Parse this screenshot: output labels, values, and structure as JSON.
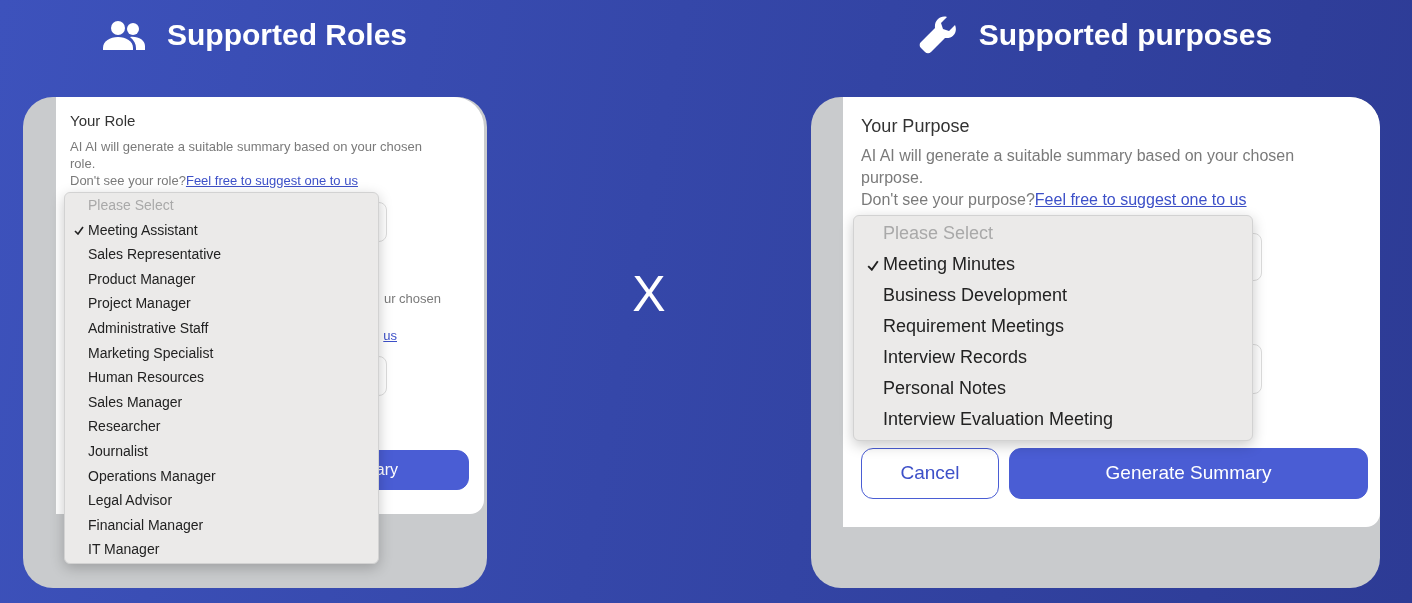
{
  "panels": [
    {
      "heading": "Supported Roles",
      "title": "Your Role",
      "description": "AI AI will generate a suitable summary based on your chosen role.",
      "prompt": "Don't see your role?",
      "link": "Feel free to suggest one to us",
      "covered_description": "ur chosen",
      "covered_link": "us",
      "buttons": [
        {
          "label": "ary",
          "kind": "primary"
        }
      ],
      "dropdown": {
        "placeholder": "Please Select",
        "options": [
          {
            "label": "Meeting Assistant",
            "selected": true
          },
          {
            "label": "Sales Representative",
            "selected": false
          },
          {
            "label": "Product Manager",
            "selected": false
          },
          {
            "label": "Project Manager",
            "selected": false
          },
          {
            "label": "Administrative Staff",
            "selected": false
          },
          {
            "label": "Marketing Specialist",
            "selected": false
          },
          {
            "label": "Human Resources",
            "selected": false
          },
          {
            "label": "Sales Manager",
            "selected": false
          },
          {
            "label": "Researcher",
            "selected": false
          },
          {
            "label": "Journalist",
            "selected": false
          },
          {
            "label": "Operations Manager",
            "selected": false
          },
          {
            "label": "Legal Advisor",
            "selected": false
          },
          {
            "label": "Financial Manager",
            "selected": false
          },
          {
            "label": "IT Manager",
            "selected": false
          }
        ]
      }
    },
    {
      "heading": "Supported purposes",
      "title": "Your Purpose",
      "description": "AI AI will generate a suitable summary based on your chosen purpose.",
      "prompt": "Don't see your purpose?",
      "link": "Feel free to suggest one to us",
      "buttons": [
        {
          "label": "Cancel",
          "kind": "outline"
        },
        {
          "label": "Generate Summary",
          "kind": "primary"
        }
      ],
      "dropdown": {
        "placeholder": "Please Select",
        "options": [
          {
            "label": "Meeting Minutes",
            "selected": true
          },
          {
            "label": "Business Development",
            "selected": false
          },
          {
            "label": "Requirement Meetings",
            "selected": false
          },
          {
            "label": "Interview Records",
            "selected": false
          },
          {
            "label": "Personal Notes",
            "selected": false
          },
          {
            "label": "Interview Evaluation Meeting",
            "selected": false
          }
        ]
      }
    }
  ],
  "separator": "X"
}
